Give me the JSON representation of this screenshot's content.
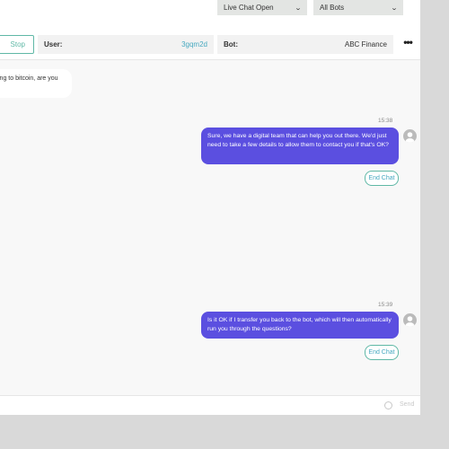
{
  "filters": {
    "status": "Live Chat Open",
    "bots": "All Bots"
  },
  "controls": {
    "stop_label": "Stop",
    "user_label": "User:",
    "user_value": "3gqm2d",
    "bot_label": "Bot:",
    "bot_value": "ABC Finance",
    "more": "•••"
  },
  "messages": [
    {
      "direction": "incoming",
      "text": "ing to bitcoin, are you"
    },
    {
      "direction": "outgoing",
      "time": "15:38",
      "text": "Sure, we have a digital team that can help you out there. We'd just need to take a few details to allow them to contact you if that's OK?",
      "action": "End Chat"
    },
    {
      "direction": "outgoing",
      "time": "15:39",
      "text": "Is it OK if I transfer you back to the bot, which will then automatically run you through the questions?",
      "action": "End Chat"
    }
  ],
  "composer": {
    "send_label": "Send"
  },
  "colors": {
    "accent": "#5b4fe0",
    "teal": "#5fb8a6",
    "link": "#47a9c0"
  }
}
